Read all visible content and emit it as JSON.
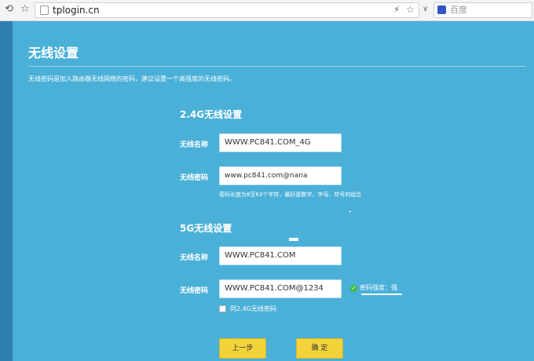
{
  "browser": {
    "url": "tplogin.cn",
    "search_placeholder": "百度",
    "back_glyph": "⟲",
    "star_glyph": "☆",
    "flash_glyph": "⚡",
    "dropdown_glyph": "∨"
  },
  "page": {
    "title": "无线设置",
    "description": "无线密码是加入路由器无线网络的密码，建议设置一个高强度的无线密码。"
  },
  "band_24": {
    "heading": "2.4G无线设置",
    "ssid_label": "无线名称",
    "ssid_value": "WWW.PC841.COM_4G",
    "password_label": "无线密码",
    "password_value": "www.pc841.com@nana",
    "hint": "密码长度为8至63个字符，最好是数字、字母、符号的组合"
  },
  "band_5": {
    "heading": "5G无线设置",
    "ssid_label": "无线名称",
    "ssid_value": "WWW.PC841.COM",
    "password_label": "无线密码",
    "password_value": "WWW.PC841.COM@1234",
    "strength_label": "密码强度：强",
    "same_as_24_label": "同2.4G无线密码",
    "same_as_24_checked": false
  },
  "buttons": {
    "prev_label": "上一步",
    "confirm_label": "确 定"
  },
  "colors": {
    "panel": "#4ab0d8",
    "accent_button": "#f2d33a",
    "strength_ok": "#3fbf3f"
  }
}
